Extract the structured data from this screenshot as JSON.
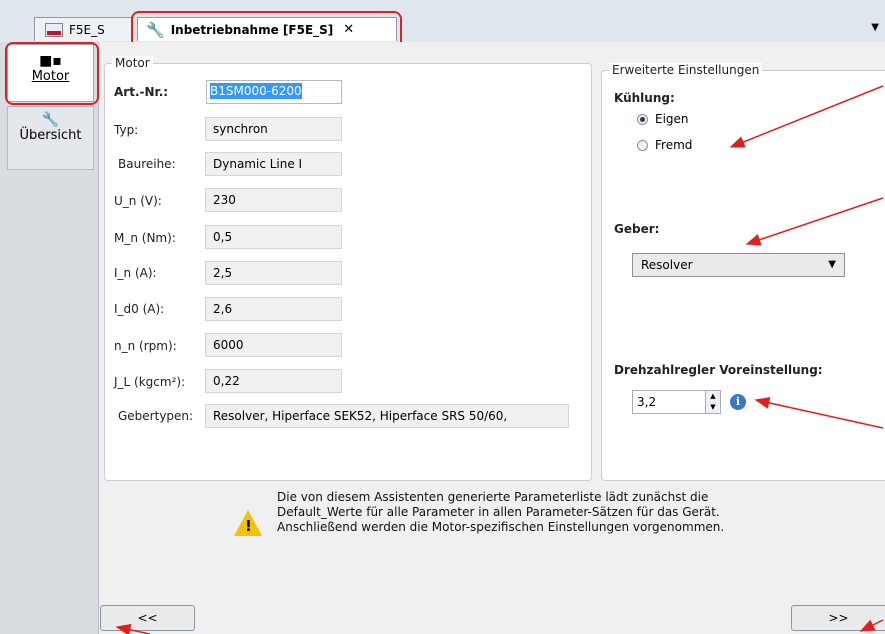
{
  "tabs": [
    {
      "label": "F5E_S",
      "icon": "keb-device-icon",
      "active": false
    },
    {
      "label": "Inbetriebnahme [F5E_S]",
      "icon": "wrench-icon",
      "active": true,
      "close": "✕"
    }
  ],
  "sidebar": {
    "items": [
      {
        "label": "Motor",
        "icon": "motor-icon",
        "selected": true
      },
      {
        "label": "Übersicht",
        "icon": "wrench-icon",
        "selected": false
      }
    ]
  },
  "motor": {
    "legend": "Motor",
    "fields": [
      {
        "label": "Art.-Nr.:",
        "value": "B1SM000-6200"
      },
      {
        "label": "Typ:",
        "value": "synchron"
      },
      {
        "label": "Baureihe:",
        "value": "Dynamic Line I"
      },
      {
        "label": "U_n (V):",
        "value": "230"
      },
      {
        "label": "M_n (Nm):",
        "value": "0,5"
      },
      {
        "label": "I_n (A):",
        "value": "2,5"
      },
      {
        "label": "I_d0 (A):",
        "value": "2,6"
      },
      {
        "label": "n_n (rpm):",
        "value": "6000"
      },
      {
        "label": "J_L (kgcm²):",
        "value": "0,22"
      },
      {
        "label": "Gebertypen:",
        "value": "Resolver, Hiperface SEK52, Hiperface SRS 50/60,"
      }
    ]
  },
  "advanced": {
    "legend": "Erweiterte Einstellungen",
    "cooling": {
      "label": "Kühlung:",
      "options": [
        "Eigen",
        "Fremd"
      ],
      "selected": "Eigen"
    },
    "encoder": {
      "label": "Geber:",
      "value": "Resolver"
    },
    "speed_controller": {
      "label": "Drehzahlregler Voreinstellung:",
      "value": "3,2",
      "info": "i"
    }
  },
  "notice": {
    "lines": [
      "Die von diesem Assistenten generierte Parameterliste lädt zunächst die",
      "Default_Werte für alle Parameter in allen Parameter-Sätzen für das Gerät.",
      "Anschließend werden die Motor-spezifischen Einstellungen vorgenommen."
    ],
    "icon": "warning-icon",
    "mark": "!"
  },
  "buttons": {
    "back": "<<",
    "next": ">>"
  },
  "colors": {
    "highlight": "#e02020",
    "selection": "#3399ff",
    "info": "#3a76c4",
    "warning": "#f2c300"
  }
}
